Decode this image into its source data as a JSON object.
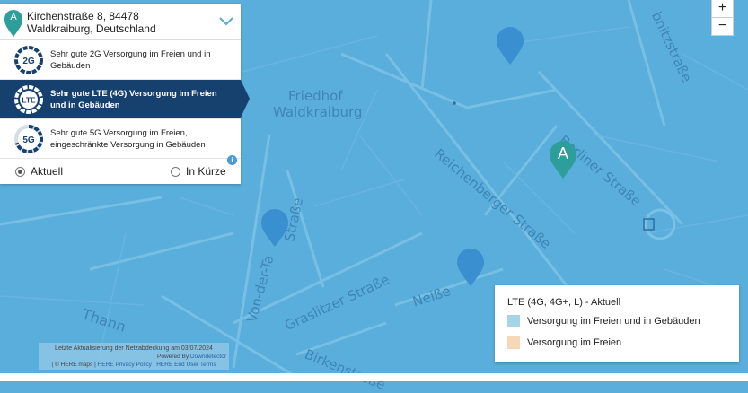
{
  "address": {
    "line1": "Kirchenstraße 8, 84478",
    "line2": "Waldkraiburg, Deutschland",
    "pin_letter": "A"
  },
  "options": [
    {
      "badge": "2G",
      "text_line1": "Sehr gute 2G Versorgung im Freien und in",
      "text_line2": "Gebäuden",
      "coverage": 0.95,
      "active": false
    },
    {
      "badge": "LTE",
      "text_line1": "Sehr gute LTE (4G) Versorgung im Freien",
      "text_line2": "und in Gebäuden",
      "coverage": 0.95,
      "active": true
    },
    {
      "badge": "5G",
      "text_line1": "Sehr gute 5G Versorgung im Freien,",
      "text_line2": "eingeschränkte Versorgung in Gebäuden",
      "coverage": 0.7,
      "active": false
    }
  ],
  "radios": {
    "current": "Aktuell",
    "soon": "In Kürze",
    "info": "i"
  },
  "zoom": {
    "in": "+",
    "out": "−"
  },
  "map_labels": {
    "friedhof1": "Friedhof",
    "friedhof2": "Waldkraiburg",
    "reichenberger": "Reichenberger Straße",
    "berliner": "Berliner Straße",
    "bnitz": "bnitzstraße",
    "von_der": "Von-der-Ta",
    "strasse_left": "Straße",
    "graslitzer": "Graslitzer Straße",
    "neisse": "Neiße",
    "birken": "Birkenstraße",
    "thann": "Thann"
  },
  "marker_letter": "A",
  "legend": {
    "title": "LTE (4G, 4G+, L) - Aktuell",
    "items": [
      {
        "label": "Versorgung im Freien und in Gebäuden",
        "color": "#a7d3ea"
      },
      {
        "label": "Versorgung im Freien",
        "color": "#f6d7b7"
      }
    ]
  },
  "footer": {
    "update": "Letzte Aktualisierung der Netzabdeckung am 03/07/2024",
    "powered": "Powered By",
    "powered_link": "Downdetector",
    "copyright": "| © HERE maps |",
    "privacy": "HERE Privacy Policy",
    "sep": "|",
    "terms": "HERE End User Terms"
  },
  "colors": {
    "map_bg": "#5aaedc",
    "road": "#7cc1e6",
    "marker_blue": "#3a8fd0",
    "marker_green": "#2e9e9a",
    "panel_active": "#16406e"
  }
}
